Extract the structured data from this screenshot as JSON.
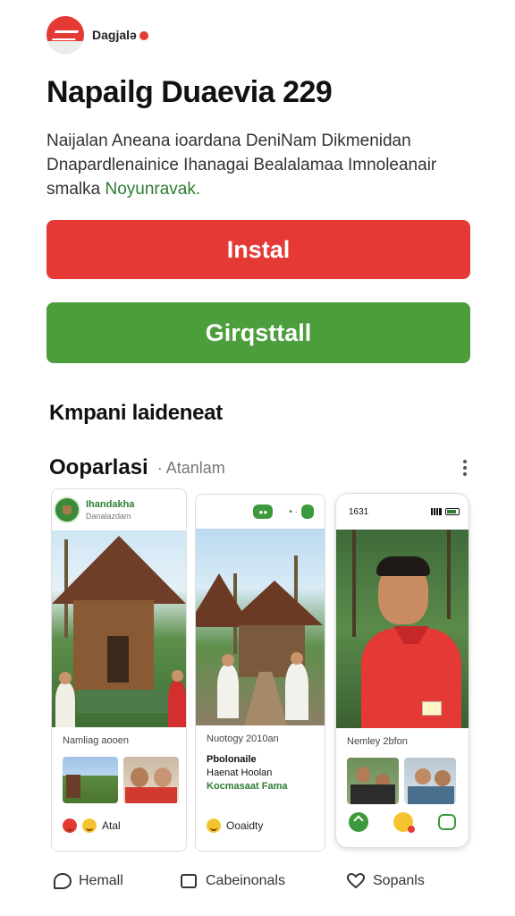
{
  "header": {
    "brand_name": "Dagjalə"
  },
  "hero": {
    "title": "Napailg Duaevia 229",
    "description_lines": [
      "Naijalan Aneana ioardana DeniNam Dikmenidan",
      "Dnapardlenainice Ihanagai Bealalamaa Imnoleanair"
    ],
    "description_tail": "smalka ",
    "description_link": "Noyunravak."
  },
  "buttons": {
    "install_label": "Instal",
    "uninstall_label": "Girqsttall"
  },
  "sections": {
    "kmpani_title": "Kmpani laideneat",
    "oparasi_title": "Ooparlasi",
    "oparasi_sub": "· Atanlam"
  },
  "cards": [
    {
      "account_name": "Ihandakha",
      "account_handle": "Danalazdam",
      "meta": "Namliag aooen",
      "reaction_label": "Atal"
    },
    {
      "meta": "Nuotogy 2010an",
      "caption_line1": "Pbolonaile",
      "caption_line2": "Haenat Hoolan",
      "caption_line3": "Kocmasaat Fama",
      "reaction_label": "Ooaidty"
    },
    {
      "status_time": "1631",
      "meta": "Nemley 2bfon"
    }
  ],
  "bottom_nav": [
    {
      "label": "Hemall",
      "icon": "chat-bubble-icon"
    },
    {
      "label": "Cabeinonals",
      "icon": "comment-box-icon"
    },
    {
      "label": "Sopanls",
      "icon": "heart-icon"
    }
  ],
  "colors": {
    "red": "#e53935",
    "green": "#4c9d3c",
    "text": "#111111"
  }
}
